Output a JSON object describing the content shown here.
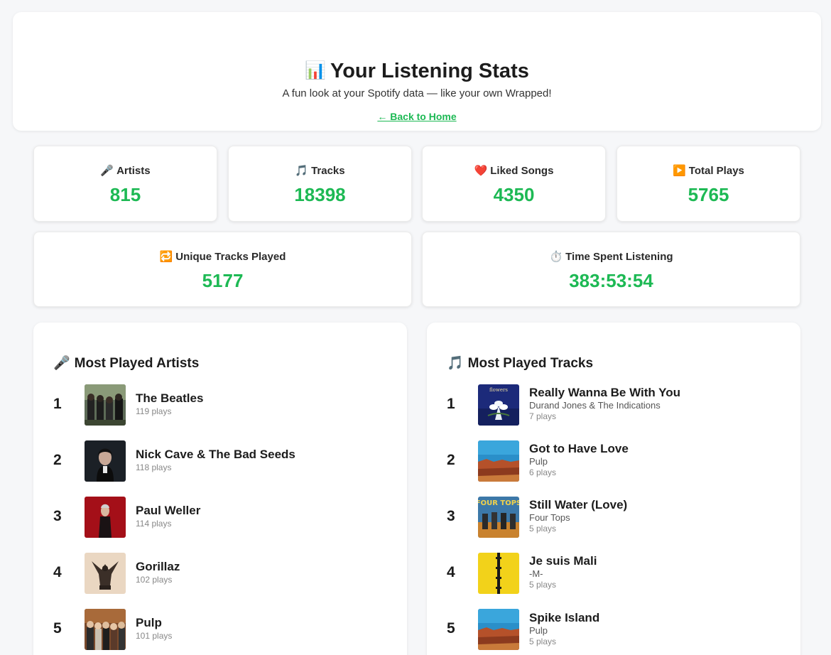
{
  "header": {
    "title_emoji": "📊",
    "title": "Your Listening Stats",
    "subtitle": "A fun look at your Spotify data — like your own Wrapped!",
    "back_link": "← Back to Home"
  },
  "stats": [
    {
      "emoji": "🎤",
      "label": "Artists",
      "value": "815"
    },
    {
      "emoji": "🎵",
      "label": "Tracks",
      "value": "18398"
    },
    {
      "emoji": "❤️",
      "label": "Liked Songs",
      "value": "4350"
    },
    {
      "emoji": "▶️",
      "label": "Total Plays",
      "value": "5765"
    },
    {
      "emoji": "🔁",
      "label": "Unique Tracks Played",
      "value": "5177"
    },
    {
      "emoji": "⏱️",
      "label": "Time Spent Listening",
      "value": "383:53:54"
    }
  ],
  "artists": {
    "emoji": "🎤",
    "title": "Most Played Artists",
    "items": [
      {
        "rank": "1",
        "name": "The Beatles",
        "plays": "119 plays"
      },
      {
        "rank": "2",
        "name": "Nick Cave & The Bad Seeds",
        "plays": "118 plays"
      },
      {
        "rank": "3",
        "name": "Paul Weller",
        "plays": "114 plays"
      },
      {
        "rank": "4",
        "name": "Gorillaz",
        "plays": "102 plays"
      },
      {
        "rank": "5",
        "name": "Pulp",
        "plays": "101 plays"
      }
    ]
  },
  "tracks": {
    "emoji": "🎵",
    "title": "Most Played Tracks",
    "items": [
      {
        "rank": "1",
        "name": "Really Wanna Be With You",
        "artist": "Durand Jones & The Indications",
        "plays": "7 plays"
      },
      {
        "rank": "2",
        "name": "Got to Have Love",
        "artist": "Pulp",
        "plays": "6 plays"
      },
      {
        "rank": "3",
        "name": "Still Water (Love)",
        "artist": "Four Tops",
        "plays": "5 plays"
      },
      {
        "rank": "4",
        "name": "Je suis Mali",
        "artist": "-M-",
        "plays": "5 plays"
      },
      {
        "rank": "5",
        "name": "Spike Island",
        "artist": "Pulp",
        "plays": "5 plays"
      }
    ]
  },
  "colors": {
    "accent": "#1db954",
    "background": "#f6f7f9"
  }
}
